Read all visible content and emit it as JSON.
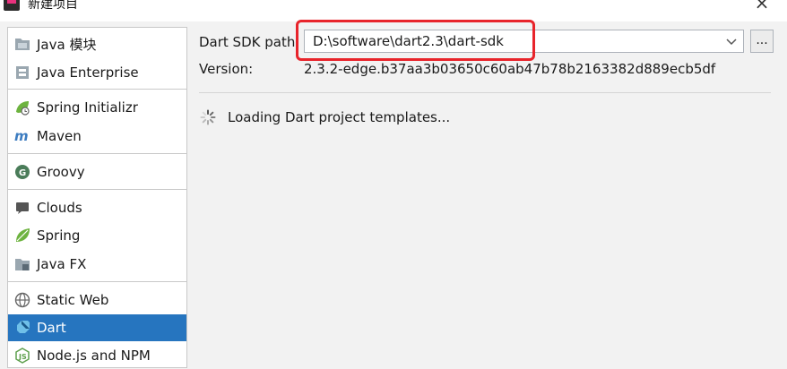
{
  "window": {
    "title": "新建项目",
    "close_glyph": "×"
  },
  "sidebar": {
    "items": [
      {
        "label": "Java 模块",
        "icon": "java-module-icon"
      },
      {
        "label": "Java Enterprise",
        "icon": "java-enterprise-icon"
      },
      {
        "label": "Spring Initializr",
        "icon": "spring-initializr-icon"
      },
      {
        "label": "Maven",
        "icon": "maven-icon"
      },
      {
        "label": "Groovy",
        "icon": "groovy-icon"
      },
      {
        "label": "Clouds",
        "icon": "clouds-icon"
      },
      {
        "label": "Spring",
        "icon": "spring-leaf-icon"
      },
      {
        "label": "Java FX",
        "icon": "java-fx-icon"
      },
      {
        "label": "Static Web",
        "icon": "static-web-icon"
      },
      {
        "label": "Dart",
        "icon": "dart-icon",
        "selected": true
      },
      {
        "label": "Node.js and NPM",
        "icon": "nodejs-icon"
      }
    ]
  },
  "form": {
    "sdk_path_label": "Dart SDK path:",
    "sdk_path_value": "D:\\software\\dart2.3\\dart-sdk",
    "browse_label": "...",
    "version_label": "Version:",
    "version_value": "2.3.2-edge.b37aa3b03650c60ab47b78b2163382d889ecb5df",
    "loading_text": "Loading Dart project templates..."
  },
  "colors": {
    "selection": "#2675bf",
    "highlight_border": "#e8242b",
    "groovy_badge": "#4a7c59",
    "spring_green": "#6db33f",
    "node_green": "#5fa04e"
  }
}
